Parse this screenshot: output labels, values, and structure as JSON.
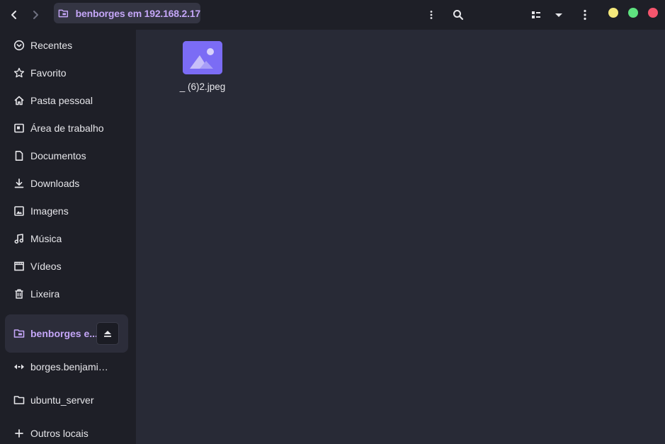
{
  "header": {
    "path_label": "benborges em 192.168.2.17",
    "icons": [
      "back-icon",
      "forward-icon",
      "network-folder-icon",
      "kebab-icon",
      "search-icon",
      "view-list-icon",
      "dropdown-icon",
      "menu-icon"
    ],
    "window_dots": {
      "minimize": "#f4e87c",
      "maximize": "#5ee27f",
      "close": "#f5556d"
    }
  },
  "sidebar": {
    "items": [
      {
        "label": "Recentes",
        "icon": "clock-icon"
      },
      {
        "label": "Favorito",
        "icon": "star-icon"
      },
      {
        "label": "Pasta pessoal",
        "icon": "home-icon"
      },
      {
        "label": "Área de trabalho",
        "icon": "desktop-icon"
      },
      {
        "label": "Documentos",
        "icon": "document-icon"
      },
      {
        "label": "Downloads",
        "icon": "download-icon"
      },
      {
        "label": "Imagens",
        "icon": "image-icon"
      },
      {
        "label": "Música",
        "icon": "music-icon"
      },
      {
        "label": "Vídeos",
        "icon": "video-icon"
      },
      {
        "label": "Lixeira",
        "icon": "trash-icon"
      }
    ],
    "active_mount": {
      "label": "benborges e...",
      "icon": "network-folder-icon"
    },
    "mounts": [
      {
        "label": "borges.benjamim...",
        "icon": "network-icon"
      },
      {
        "label": "ubuntu_server",
        "icon": "folder-icon"
      },
      {
        "label": "Outros locais",
        "icon": "plus-icon"
      }
    ]
  },
  "main": {
    "files": [
      {
        "name": "_ (6)2.jpeg",
        "icon": "image-file-icon"
      }
    ]
  },
  "colors": {
    "accent": "#c4a6f7",
    "thumb": "#7b6cf5",
    "main_bg": "#282a36",
    "sidebar_bg": "#1e1f27"
  }
}
